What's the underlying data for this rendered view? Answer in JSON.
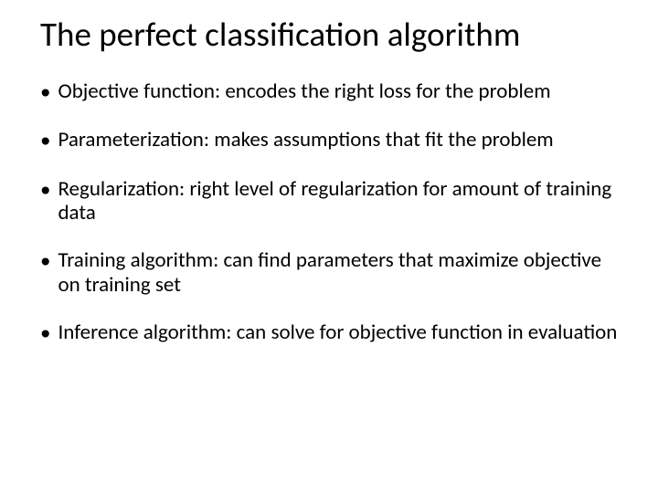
{
  "title": "The perfect classification algorithm",
  "bullets": [
    "Objective function: encodes the right loss for the problem",
    "Parameterization: makes assumptions that fit the problem",
    "Regularization: right level of regularization for amount of training data",
    "Training algorithm: can find parameters that maximize objective on training set",
    "Inference algorithm: can solve for objective function in evaluation"
  ]
}
